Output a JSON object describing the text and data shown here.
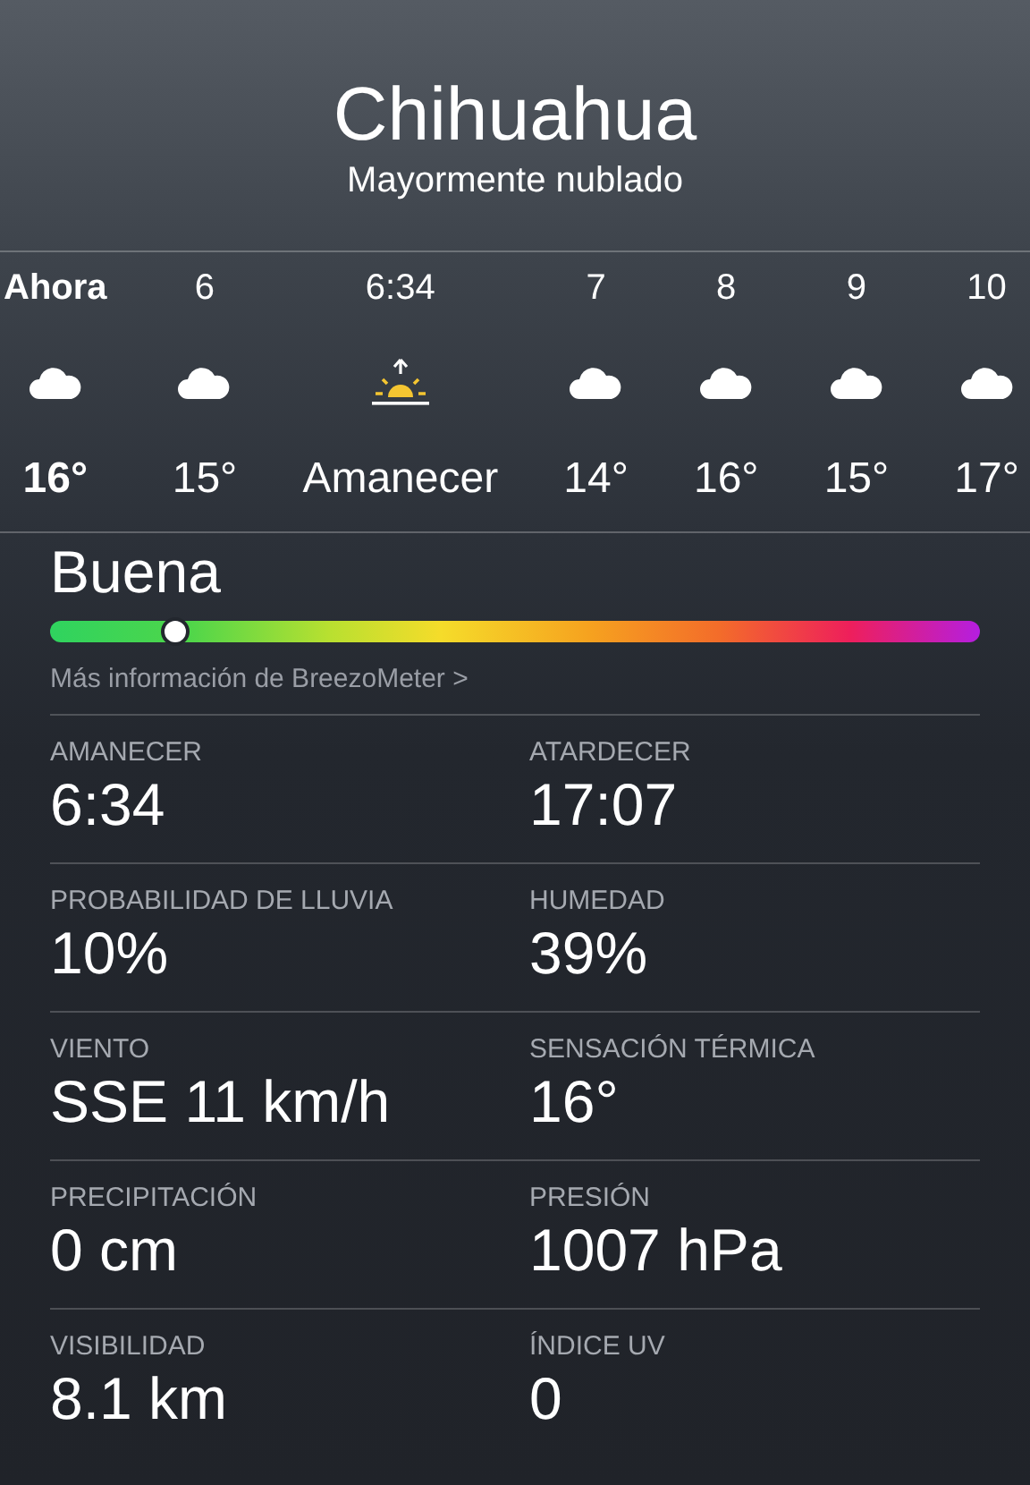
{
  "header": {
    "city": "Chihuahua",
    "condition": "Mayormente nublado"
  },
  "hourly": [
    {
      "time": "Ahora",
      "kind": "cloud",
      "temp": "16°",
      "now": true
    },
    {
      "time": "6",
      "kind": "cloud",
      "temp": "15°",
      "now": false
    },
    {
      "time": "6:34",
      "kind": "sunrise",
      "temp": "Amanecer",
      "now": false
    },
    {
      "time": "7",
      "kind": "cloud",
      "temp": "14°",
      "now": false
    },
    {
      "time": "8",
      "kind": "cloud",
      "temp": "16°",
      "now": false
    },
    {
      "time": "9",
      "kind": "cloud",
      "temp": "15°",
      "now": false
    },
    {
      "time": "10",
      "kind": "cloud",
      "temp": "17°",
      "now": false
    }
  ],
  "air_quality": {
    "label": "Buena",
    "level": 0.135,
    "link": "Más información de BreezoMeter",
    "link_arrow": ">"
  },
  "details": [
    [
      {
        "label": "AMANECER",
        "value": "6:34"
      },
      {
        "label": "ATARDECER",
        "value": "17:07"
      }
    ],
    [
      {
        "label": "PROBABILIDAD DE LLUVIA",
        "value": "10%"
      },
      {
        "label": "HUMEDAD",
        "value": "39%"
      }
    ],
    [
      {
        "label": "VIENTO",
        "value": "SSE 11 km/h"
      },
      {
        "label": "SENSACIÓN TÉRMICA",
        "value": "16°"
      }
    ],
    [
      {
        "label": "PRECIPITACIÓN",
        "value": "0 cm"
      },
      {
        "label": "PRESIÓN",
        "value": "1007 hPa"
      }
    ],
    [
      {
        "label": "VISIBILIDAD",
        "value": "8.1 km"
      },
      {
        "label": "ÍNDICE UV",
        "value": "0"
      }
    ]
  ]
}
